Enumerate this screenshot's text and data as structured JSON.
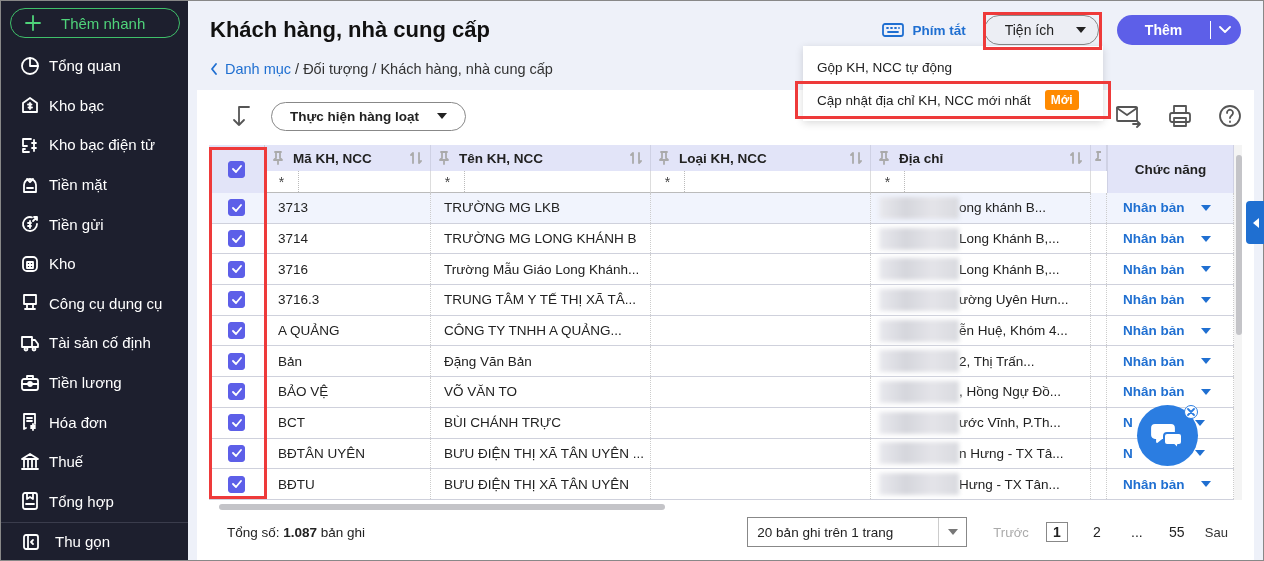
{
  "sidebar": {
    "quick_add": "Thêm nhanh",
    "items": [
      {
        "label": "Tổng quan"
      },
      {
        "label": "Kho bạc"
      },
      {
        "label": "Kho bạc điện tử"
      },
      {
        "label": "Tiền mặt"
      },
      {
        "label": "Tiền gửi"
      },
      {
        "label": "Kho"
      },
      {
        "label": "Công cụ dụng cụ"
      },
      {
        "label": "Tài sản cố định"
      },
      {
        "label": "Tiền lương"
      },
      {
        "label": "Hóa đơn"
      },
      {
        "label": "Thuế"
      },
      {
        "label": "Tổng hợp"
      }
    ],
    "collapse": "Thu gọn"
  },
  "page": {
    "title": "Khách hàng, nhà cung cấp",
    "breadcrumb_link": "Danh mục",
    "breadcrumb_rest": "/ Đối tượng / Khách hàng, nhà cung cấp",
    "shortcuts": "Phím tắt",
    "utilities": "Tiện ích",
    "add": "Thêm"
  },
  "utilities_menu": [
    {
      "label": "Gộp KH, NCC tự động",
      "highlighted": false
    },
    {
      "label": "Cập nhật địa chỉ KH, NCC mới nhất",
      "badge": "Mới",
      "highlighted": true
    }
  ],
  "toolbar": {
    "bulk_action": "Thực hiện hàng loạt"
  },
  "table": {
    "all_checked": true,
    "columns": [
      "Mã KH, NCC",
      "Tên KH, NCC",
      "Loại KH, NCC",
      "Địa chỉ"
    ],
    "filter": "*",
    "action_column": "Chức năng",
    "rows": [
      {
        "code": "3713",
        "name": "TRƯỜNG MG LKB",
        "address": "ong khánh B...",
        "checked": true,
        "hovered": true,
        "action": "Nhân bản"
      },
      {
        "code": "3714",
        "name": "TRƯỜNG MG LONG KHÁNH B",
        "address": "Long Khánh B,...",
        "checked": true,
        "hovered": false,
        "action": "Nhân bản"
      },
      {
        "code": "3716",
        "name": "Trường Mẫu Giáo Long Khánh...",
        "address": "Long Khánh B,...",
        "checked": true,
        "hovered": false,
        "action": "Nhân bản"
      },
      {
        "code": "3716.3",
        "name": "TRUNG TÂM Y TẾ THỊ XÃ TÂ...",
        "address": "ường Uyên Hưn...",
        "checked": true,
        "hovered": false,
        "action": "Nhân bản"
      },
      {
        "code": "A QUẢNG",
        "name": "CÔNG TY TNHH A QUẢNG...",
        "address": "ễn Huệ, Khóm 4...",
        "checked": true,
        "hovered": false,
        "action": "Nhân bản"
      },
      {
        "code": "Bản",
        "name": "Đặng Văn Bản",
        "address": "2, Thị Trấn...",
        "checked": true,
        "hovered": false,
        "action": "Nhân bản"
      },
      {
        "code": "BẢO VỆ",
        "name": "VÕ VĂN TO",
        "address": ", Hồng Ngự Đồ...",
        "checked": true,
        "hovered": false,
        "action": "Nhân bản"
      },
      {
        "code": "BCT",
        "name": "BÙI CHÁNH TRỰC",
        "address": "ước Vĩnh, P.Th...",
        "checked": true,
        "hovered": false,
        "action": "N"
      },
      {
        "code": "BĐTÂN UYÊN",
        "name": "BƯU ĐIỆN THỊ XÃ TÂN UYÊN ...",
        "address": "n Hưng -  TX Tâ...",
        "checked": true,
        "hovered": false,
        "action": "N"
      },
      {
        "code": "BĐTU",
        "name": "BƯU ĐIỆN THỊ XÃ TÂN UYÊN",
        "address": "Hưng - TX Tân...",
        "checked": true,
        "hovered": false,
        "action": "Nhân bản"
      }
    ]
  },
  "footer": {
    "total_label": "Tổng số:",
    "total": "1.087",
    "total_unit": "bản ghi",
    "page_size": "20 bản ghi trên 1 trang",
    "prev": "Trước",
    "prev_disabled": true,
    "pages": [
      {
        "label": "1",
        "selected": true
      },
      {
        "label": "2",
        "selected": false
      },
      {
        "label": "...",
        "selected": false
      },
      {
        "label": "55",
        "selected": false
      }
    ],
    "next": "Sau"
  }
}
